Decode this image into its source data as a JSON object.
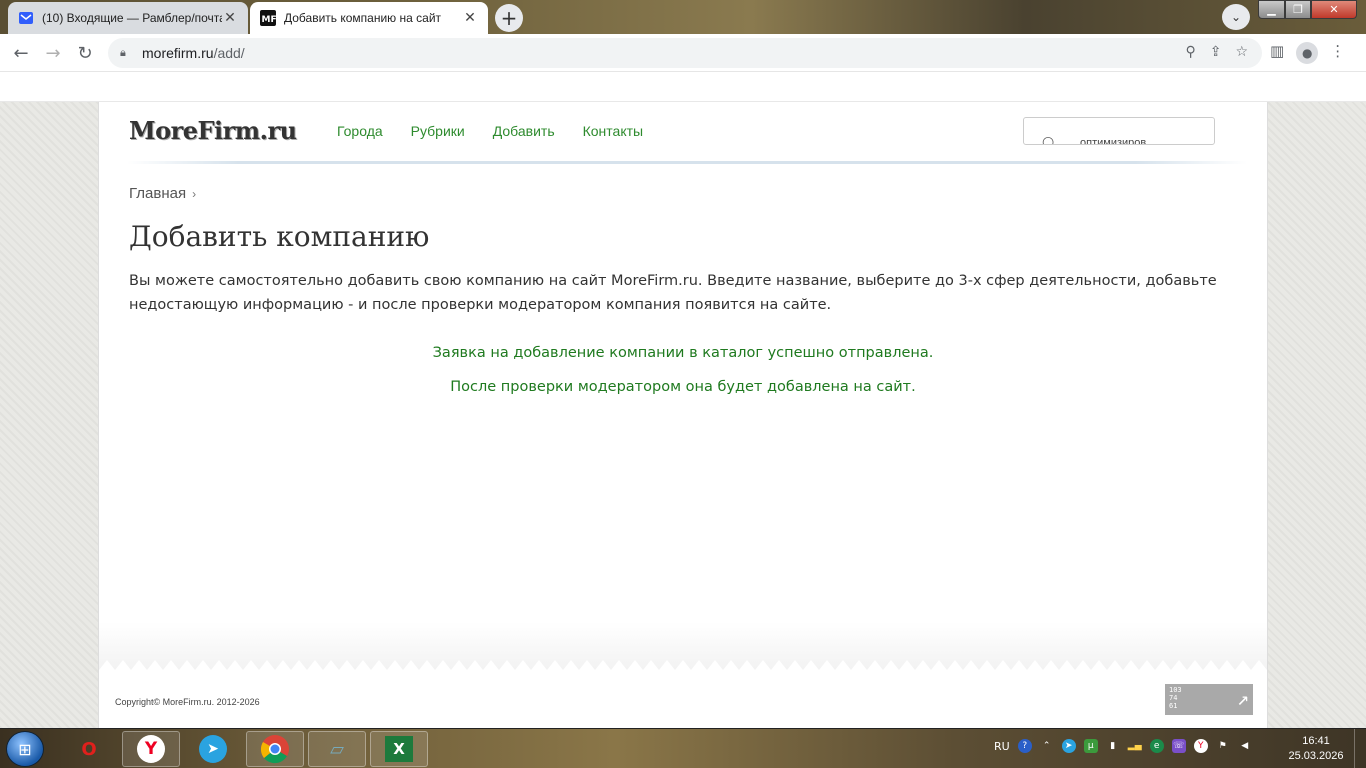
{
  "browser": {
    "tabs": [
      {
        "title": "(10) Входящие — Рамблер/почта",
        "active": false,
        "icon": "mail-icon"
      },
      {
        "title": "Добавить компанию на сайт",
        "active": true,
        "icon": "mf-favicon"
      }
    ],
    "new_tab_label": "+",
    "url_host": "morefirm.ru",
    "url_path": "/add/"
  },
  "site": {
    "logo": "MoreFirm.ru",
    "nav": [
      "Города",
      "Рубрики",
      "Добавить",
      "Контакты"
    ],
    "search_value": "оптимизиров",
    "breadcrumb": {
      "home": "Главная",
      "separator": "›"
    },
    "page_title": "Добавить компанию",
    "intro": "Вы можете самостоятельно добавить свою компанию на сайт MoreFirm.ru. Введите название, выберите до 3-х сфер деятельности, добавьте недостающую информацию - и после проверки модератором компания появится на сайте.",
    "success_line1": "Заявка на добавление компании в каталог успешно отправлена.",
    "success_line2": "После проверки модератором она будет добавлена на сайт.",
    "copyright": "Copyright© MoreFirm.ru. 2012-2026",
    "counter": [
      "103",
      "74",
      "61"
    ],
    "colors": {
      "link": "#2e8b2e",
      "success": "#1f7a1f"
    }
  },
  "taskbar": {
    "language": "RU",
    "time": "16:41",
    "date": "25.03.2026"
  }
}
